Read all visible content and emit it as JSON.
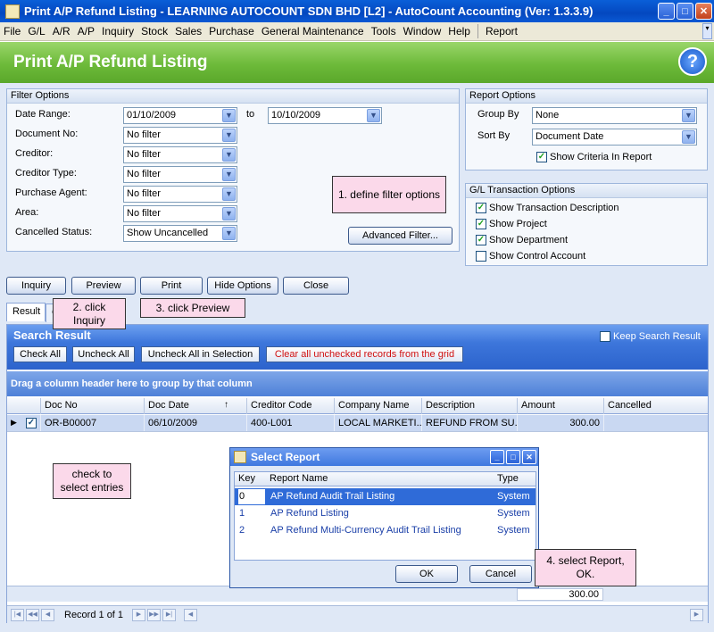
{
  "window": {
    "title": "Print A/P Refund Listing - LEARNING AUTOCOUNT SDN BHD [L2] - AutoCount Accounting (Ver: 1.3.3.9)"
  },
  "menu": [
    "File",
    "G/L",
    "A/R",
    "A/P",
    "Inquiry",
    "Stock",
    "Sales",
    "Purchase",
    "General Maintenance",
    "Tools",
    "Window",
    "Help",
    "Report"
  ],
  "page_title": "Print A/P Refund Listing",
  "filter": {
    "title": "Filter Options",
    "date_range_label": "Date Range:",
    "date_from": "01/10/2009",
    "to_label": "to",
    "date_to": "10/10/2009",
    "document_no_label": "Document No:",
    "document_no": "No filter",
    "creditor_label": "Creditor:",
    "creditor": "No filter",
    "creditor_type_label": "Creditor Type:",
    "creditor_type": "No filter",
    "purchase_agent_label": "Purchase Agent:",
    "purchase_agent": "No filter",
    "area_label": "Area:",
    "area": "No filter",
    "cancelled_label": "Cancelled Status:",
    "cancelled": "Show Uncancelled",
    "advanced_filter": "Advanced Filter..."
  },
  "report_options": {
    "title": "Report Options",
    "group_by_label": "Group By",
    "group_by": "None",
    "sort_by_label": "Sort By",
    "sort_by": "Document Date",
    "show_criteria": "Show Criteria In Report"
  },
  "gl_options": {
    "title": "G/L Transaction Options",
    "show_description": "Show Transaction Description",
    "show_project": "Show Project",
    "show_department": "Show Department",
    "show_control": "Show Control Account"
  },
  "actions": {
    "inquiry": "Inquiry",
    "preview": "Preview",
    "print": "Print",
    "hide_options": "Hide Options",
    "close": "Close"
  },
  "tabs": {
    "result": "Result",
    "criteria": "C"
  },
  "search_result": {
    "title": "Search Result",
    "keep_search": "Keep Search Result",
    "check_all": "Check All",
    "uncheck_all": "Uncheck All",
    "uncheck_sel": "Uncheck All in Selection",
    "clear_unchecked": "Clear all unchecked records from the grid",
    "group_hint": "Drag a column header here to group by that column",
    "columns": [
      "Doc No",
      "Doc Date",
      "Creditor Code",
      "Company Name",
      "Description",
      "Amount",
      "Cancelled"
    ],
    "row": {
      "doc_no": "OR-B00007",
      "doc_date": "06/10/2009",
      "creditor_code": "400-L001",
      "company": "LOCAL MARKETI...",
      "description": "REFUND FROM SU...",
      "amount": "300.00",
      "cancelled": ""
    },
    "total": "300.00",
    "record_text": "Record 1 of 1"
  },
  "dialog": {
    "title": "Select Report",
    "col_key": "Key",
    "col_name": "Report Name",
    "col_type": "Type",
    "rows": [
      {
        "key": "0",
        "name": "AP Refund Audit Trail Listing",
        "type": "System"
      },
      {
        "key": "1",
        "name": "AP Refund Listing",
        "type": "System"
      },
      {
        "key": "2",
        "name": "AP Refund Multi-Currency Audit Trail Listing",
        "type": "System"
      }
    ],
    "ok": "OK",
    "cancel": "Cancel"
  },
  "callouts": {
    "c1": "1. define filter options",
    "c2": "2. click Inquiry",
    "c3": "3. click Preview",
    "c4": "check to select entries",
    "c5": "4. select Report, OK."
  }
}
